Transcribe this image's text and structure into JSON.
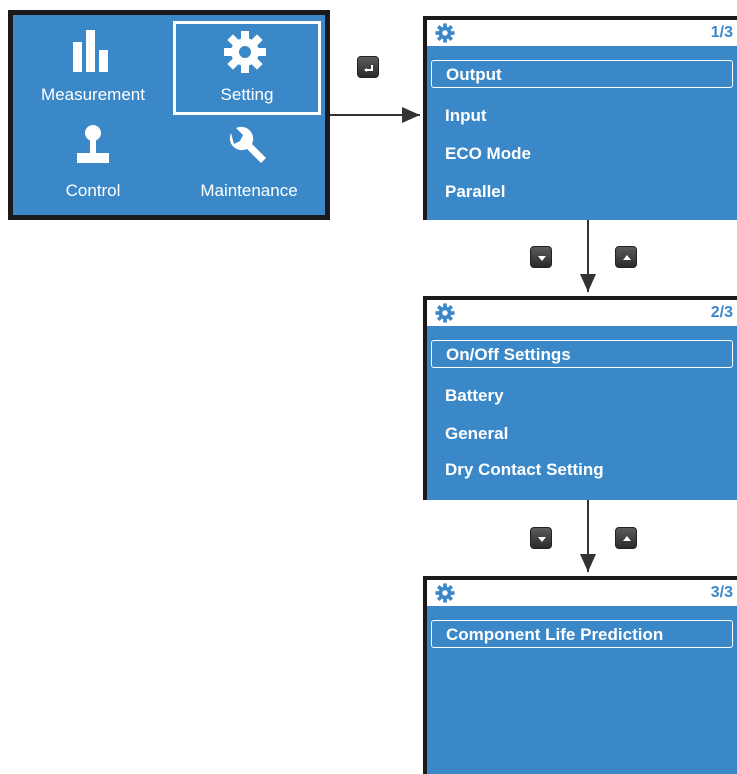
{
  "main_menu": {
    "tiles": [
      {
        "label": "Measurement",
        "icon": "bar-chart-icon",
        "selected": false
      },
      {
        "label": "Setting",
        "icon": "gear-icon",
        "selected": true
      },
      {
        "label": "Control",
        "icon": "joystick-icon",
        "selected": false
      },
      {
        "label": "Maintenance",
        "icon": "wrench-icon",
        "selected": false
      }
    ]
  },
  "keys": {
    "enter": "enter-key-icon",
    "down": "down-key-icon",
    "up": "up-key-icon"
  },
  "screens": [
    {
      "page": "1/3",
      "items": [
        "Output",
        "Input",
        "ECO Mode",
        "Parallel"
      ]
    },
    {
      "page": "2/3",
      "items": [
        "On/Off Settings",
        "Battery",
        "General",
        "Dry Contact Setting"
      ]
    },
    {
      "page": "3/3",
      "items": [
        "Component Life Prediction"
      ]
    }
  ],
  "colors": {
    "panel_blue": "#3b88c9",
    "frame": "#1a1a1a",
    "highlight": "#ffffff"
  }
}
